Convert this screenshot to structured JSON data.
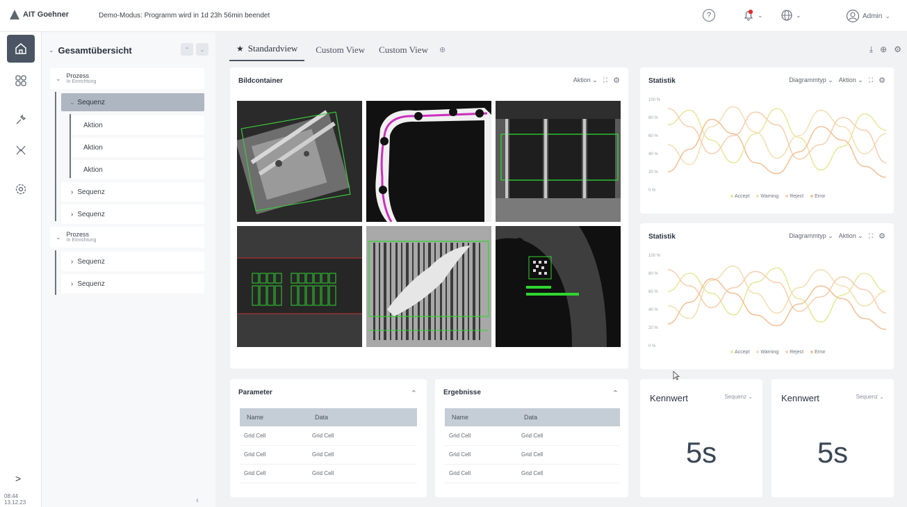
{
  "header": {
    "logo_text": "AIT Goehner",
    "demo_message": "Demo-Modus: Programm wird in 1d 23h 56min beendet",
    "user_label": "Admin"
  },
  "rail": {
    "items": [
      "home-icon",
      "dashboard-icon",
      "wrench-icon",
      "scissors-icon",
      "settings-icon"
    ],
    "time": "08:44",
    "date": "13.12.23"
  },
  "tree": {
    "title": "Gesamtübersicht",
    "process1": {
      "title": "Prozess",
      "status": "In Einrichtung"
    },
    "selected_sequence": "Sequenz",
    "actions": [
      "Aktion",
      "Aktion",
      "Aktion"
    ],
    "sequences1": [
      "Sequenz",
      "Sequenz"
    ],
    "process2": {
      "title": "Prozess",
      "status": "In Einrichtung"
    },
    "sequences2": [
      "Sequenz",
      "Sequenz"
    ]
  },
  "tabs": [
    {
      "label": "Standardview",
      "active": true
    },
    {
      "label": "Custom View",
      "active": false
    },
    {
      "label": "Custom View",
      "active": false
    }
  ],
  "image_container": {
    "title": "Bildcontainer",
    "action": "Aktion"
  },
  "stat1": {
    "title": "Statistik",
    "diagram_type": "Diagrammtyp",
    "action": "Aktion"
  },
  "stat2": {
    "title": "Statistik",
    "diagram_type": "Diagrammtyp",
    "action": "Aktion"
  },
  "parameter": {
    "title": "Parameter",
    "columns": [
      "Name",
      "Data"
    ],
    "rows": [
      [
        "Grid Cell",
        "Grid Cell"
      ],
      [
        "Grid Cell",
        "Grid Cell"
      ],
      [
        "Grid Cell",
        "Grid Cell"
      ]
    ]
  },
  "results": {
    "title": "Ergebnisse",
    "columns": [
      "Name",
      "Data"
    ],
    "rows": [
      [
        "Grid Cell",
        "Grid Cell"
      ],
      [
        "Grid Cell",
        "Grid Cell"
      ],
      [
        "Grid Cell",
        "Grid Cell"
      ]
    ]
  },
  "kpi1": {
    "title": "Kennwert",
    "select": "Sequenz",
    "value": "5s"
  },
  "kpi2": {
    "title": "Kennwert",
    "select": "Sequenz",
    "value": "5s"
  },
  "chart_data": [
    {
      "type": "line",
      "title": "Statistik",
      "ylabels": [
        "100 %",
        "80 %",
        "60 %",
        "40 %",
        "20 %",
        "0 %"
      ],
      "ylim": [
        0,
        100
      ],
      "series": [
        {
          "name": "Accept",
          "color": "#e8e7a0",
          "values": [
            72,
            88,
            55,
            30,
            62,
            90,
            58,
            22,
            48,
            84,
            66
          ]
        },
        {
          "name": "Warning",
          "color": "#f3dfb6",
          "values": [
            50,
            28,
            70,
            92,
            64,
            35,
            60,
            88,
            70,
            40,
            62
          ]
        },
        {
          "name": "Reject",
          "color": "#f5d0b2",
          "values": [
            90,
            70,
            40,
            60,
            86,
            72,
            34,
            50,
            80,
            66,
            30
          ]
        },
        {
          "name": "Error",
          "color": "#f0c39a",
          "values": [
            20,
            45,
            78,
            62,
            30,
            18,
            42,
            70,
            55,
            26,
            14
          ]
        }
      ]
    },
    {
      "type": "line",
      "title": "Statistik",
      "ylabels": [
        "100 %",
        "80 %",
        "60 %",
        "40 %",
        "20 %",
        "0 %"
      ],
      "ylim": [
        0,
        100
      ],
      "series": [
        {
          "name": "Accept",
          "color": "#e8e7a0",
          "values": [
            60,
            80,
            58,
            34,
            70,
            86,
            52,
            26,
            56,
            80,
            60
          ]
        },
        {
          "name": "Warning",
          "color": "#f3dfb6",
          "values": [
            44,
            30,
            72,
            88,
            58,
            36,
            64,
            84,
            66,
            44,
            60
          ]
        },
        {
          "name": "Reject",
          "color": "#f5d0b2",
          "values": [
            84,
            66,
            42,
            64,
            82,
            70,
            38,
            54,
            76,
            62,
            36
          ]
        },
        {
          "name": "Error",
          "color": "#f0c39a",
          "values": [
            24,
            48,
            74,
            58,
            34,
            22,
            46,
            66,
            52,
            30,
            18
          ]
        }
      ]
    }
  ]
}
